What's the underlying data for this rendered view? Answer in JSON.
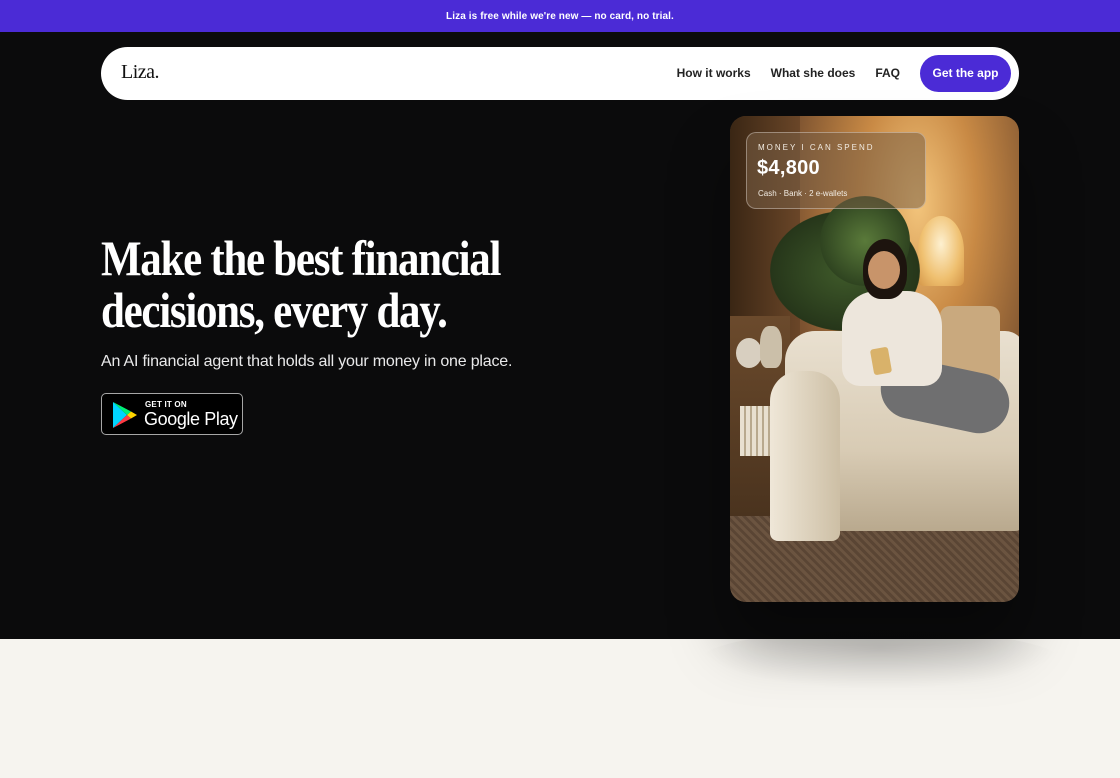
{
  "announcement": {
    "text": "Liza is free while we're new — no card, no trial."
  },
  "nav": {
    "logo": "Liza.",
    "links": [
      "How it works",
      "What she does",
      "FAQ"
    ],
    "cta": "Get the app"
  },
  "hero": {
    "headline_line1": "Make the best financial",
    "headline_line2": "decisions, every day.",
    "subhead": "An AI financial agent that holds all your money in one place.",
    "store_badge": {
      "small": "GET IT ON",
      "big": "Google Play"
    }
  },
  "balance_card": {
    "label": "MONEY I CAN SPEND",
    "amount": "$4,800",
    "sources": "Cash · Bank · 2 e-wallets"
  },
  "colors": {
    "accent": "#4b2bd6",
    "hero_bg": "#0b0b0c",
    "page_bg": "#f6f4ef"
  }
}
